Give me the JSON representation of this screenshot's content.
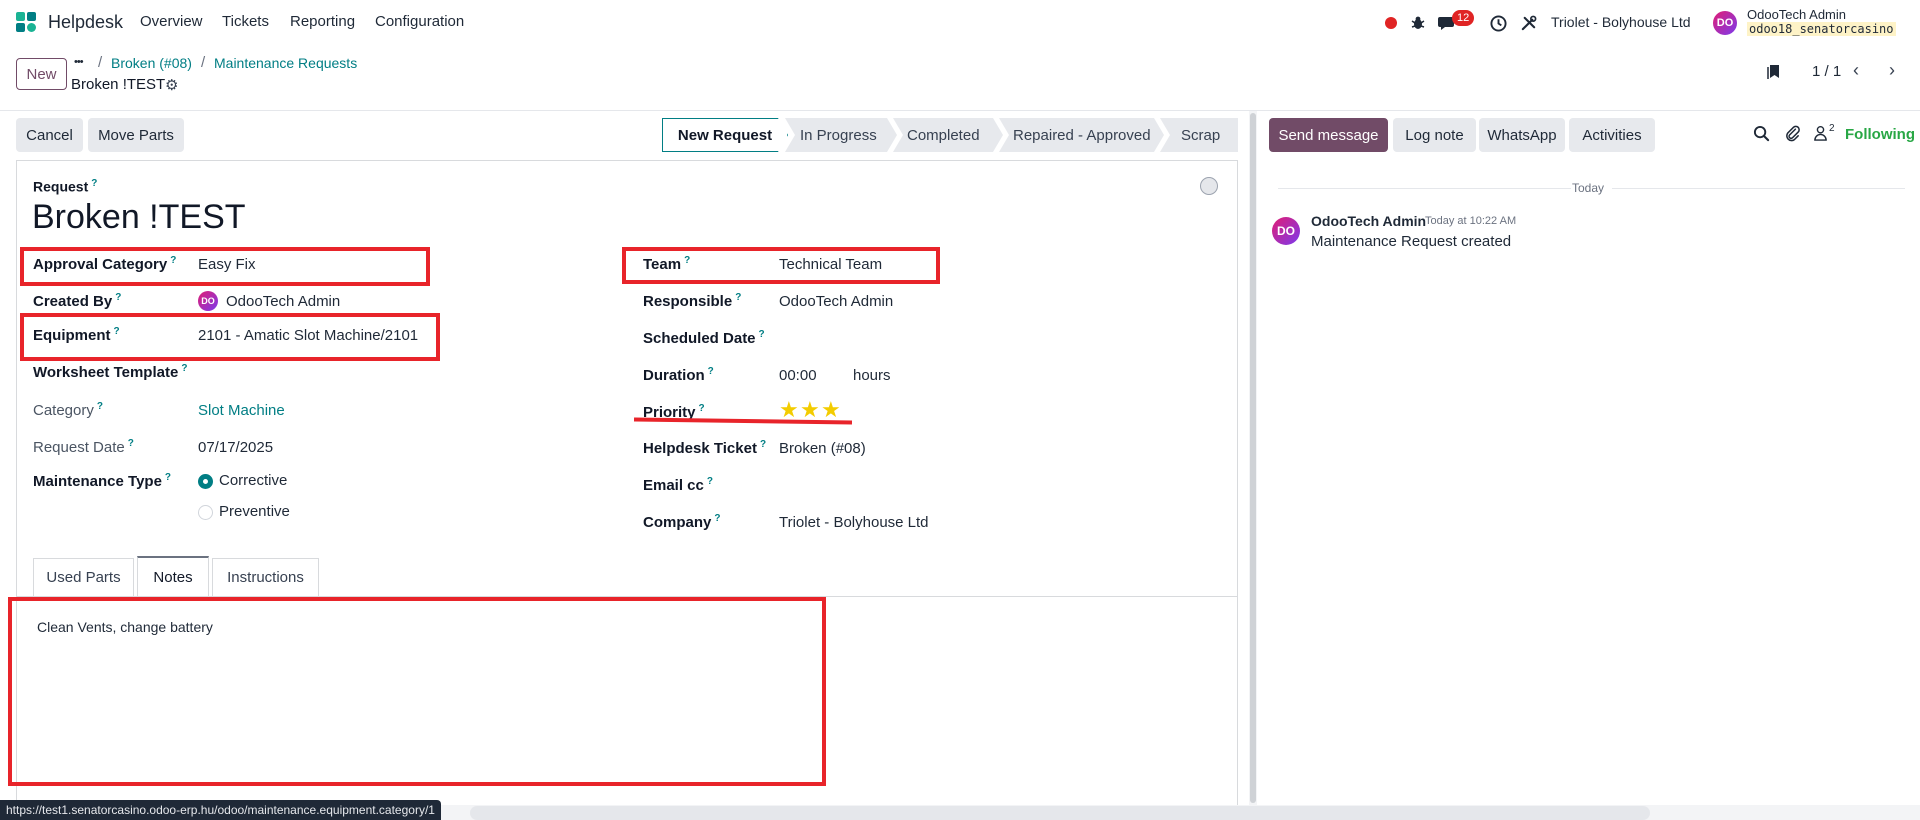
{
  "nav": {
    "app_name": "Helpdesk",
    "menu": [
      "Overview",
      "Tickets",
      "Reporting",
      "Configuration"
    ],
    "chat_badge": "12",
    "company": "Triolet - Bolyhouse Ltd",
    "user_name": "OdooTech Admin",
    "db_name": "odoo18_senatorcasino",
    "avatar_initials": "DO"
  },
  "control_panel": {
    "new_label": "New",
    "dots": "•••",
    "breadcrumb": [
      "Broken (#08)",
      "Maintenance Requests"
    ],
    "record_title": "Broken !TEST",
    "pager": "1 / 1"
  },
  "actions": {
    "cancel": "Cancel",
    "move_parts": "Move Parts"
  },
  "stages": [
    "New Request",
    "In Progress",
    "Completed",
    "Repaired - Approved",
    "Scrap"
  ],
  "form": {
    "request_label": "Request",
    "title": "Broken !TEST",
    "approval_category_label": "Approval Category",
    "approval_category": "Easy Fix",
    "created_by_label": "Created By",
    "created_by": "OdooTech Admin",
    "equipment_label": "Equipment",
    "equipment": "2101 - Amatic Slot Machine/2101",
    "worksheet_label": "Worksheet Template",
    "category_label": "Category",
    "category": "Slot Machine",
    "request_date_label": "Request Date",
    "request_date": "07/17/2025",
    "maintenance_type_label": "Maintenance Type",
    "type_options": [
      "Corrective",
      "Preventive"
    ],
    "team_label": "Team",
    "team": "Technical Team",
    "responsible_label": "Responsible",
    "responsible": "OdooTech Admin",
    "scheduled_label": "Scheduled Date",
    "duration_label": "Duration",
    "duration": "00:00",
    "duration_unit": "hours",
    "priority_label": "Priority",
    "priority_stars": 3,
    "ticket_label": "Helpdesk Ticket",
    "ticket": "Broken (#08)",
    "email_cc_label": "Email cc",
    "company_label": "Company",
    "company": "Triolet - Bolyhouse Ltd",
    "help_mark": "?"
  },
  "tabs": [
    "Used Parts",
    "Notes",
    "Instructions"
  ],
  "notes": "Clean Vents, change battery",
  "chatter": {
    "send_message": "Send message",
    "log_note": "Log note",
    "whatsapp": "WhatsApp",
    "activities": "Activities",
    "followers_count": "2",
    "following": "Following",
    "date_separator": "Today",
    "message_author": "OdooTech Admin",
    "message_time": "Today at 10:22 AM",
    "message_body": "Maintenance Request created"
  },
  "status_url": "https://test1.senatorcasino.odoo-erp.hu/odoo/maintenance.equipment.category/1",
  "colors": {
    "accent": "#017e84",
    "primary": "#714b67",
    "highlight": "#e8242a"
  }
}
